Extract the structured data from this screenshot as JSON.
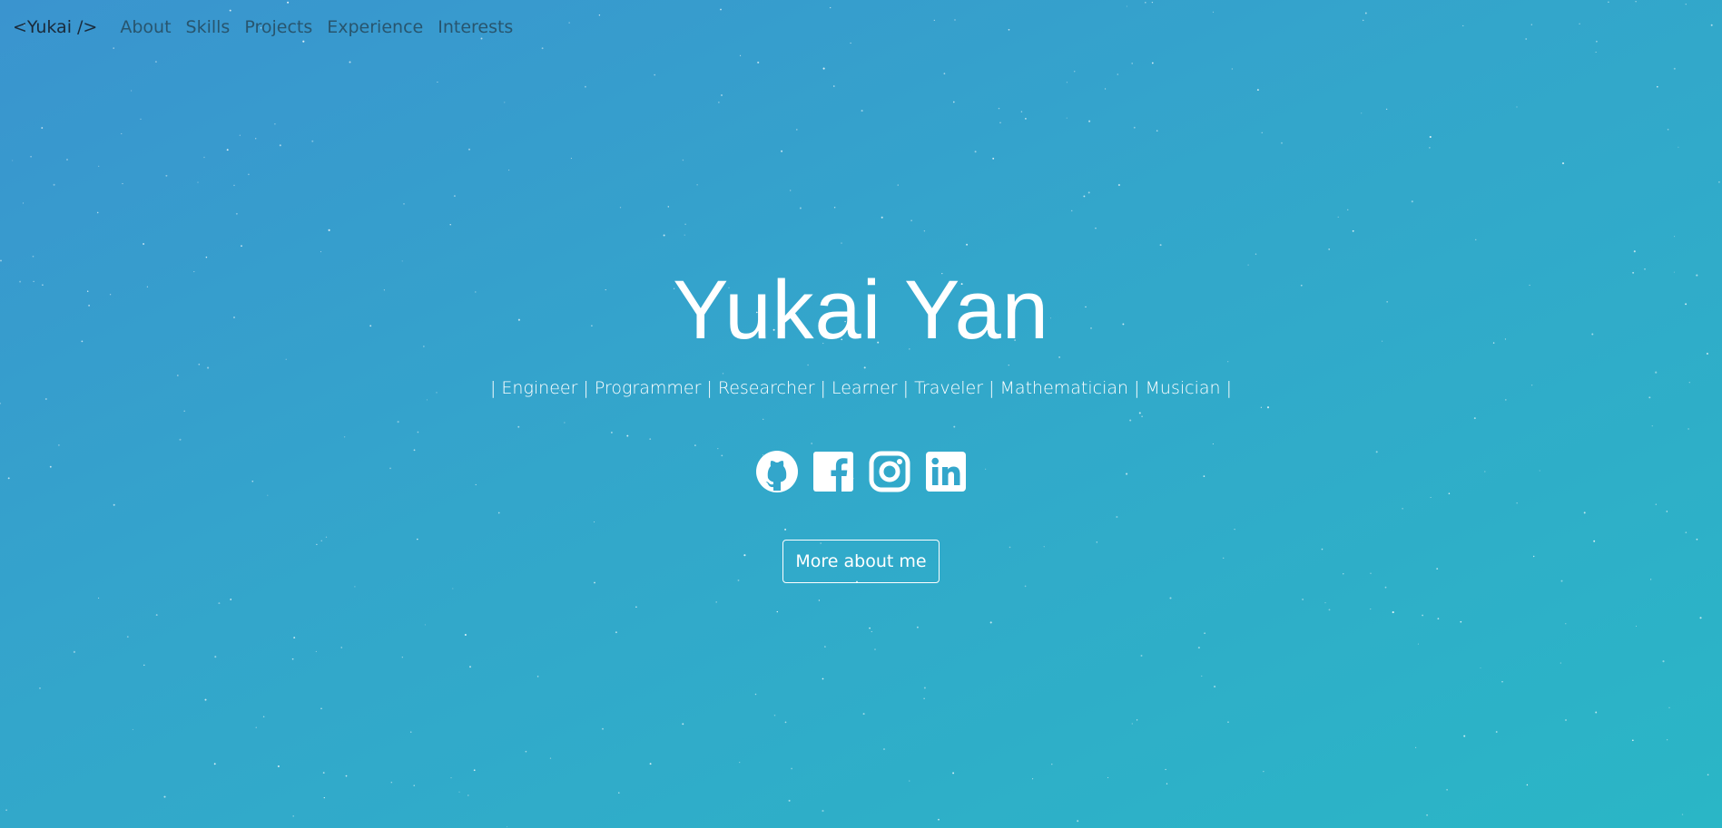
{
  "nav": {
    "brand": "<Yukai />",
    "links": [
      "About",
      "Skills",
      "Projects",
      "Experience",
      "Interests"
    ]
  },
  "hero": {
    "name": "Yukai Yan",
    "subtitle": "| Engineer | Programmer | Researcher | Learner | Traveler | Mathematician | Musician |",
    "button": "More about me"
  },
  "socials": [
    "github-icon",
    "facebook-icon",
    "instagram-icon",
    "linkedin-icon"
  ],
  "colors": {
    "gradient_start": "#3a94cf",
    "gradient_end": "#2ab6c6",
    "brand_text": "#1a2a3a",
    "nav_text": "#28556e",
    "foreground": "#ffffff"
  }
}
